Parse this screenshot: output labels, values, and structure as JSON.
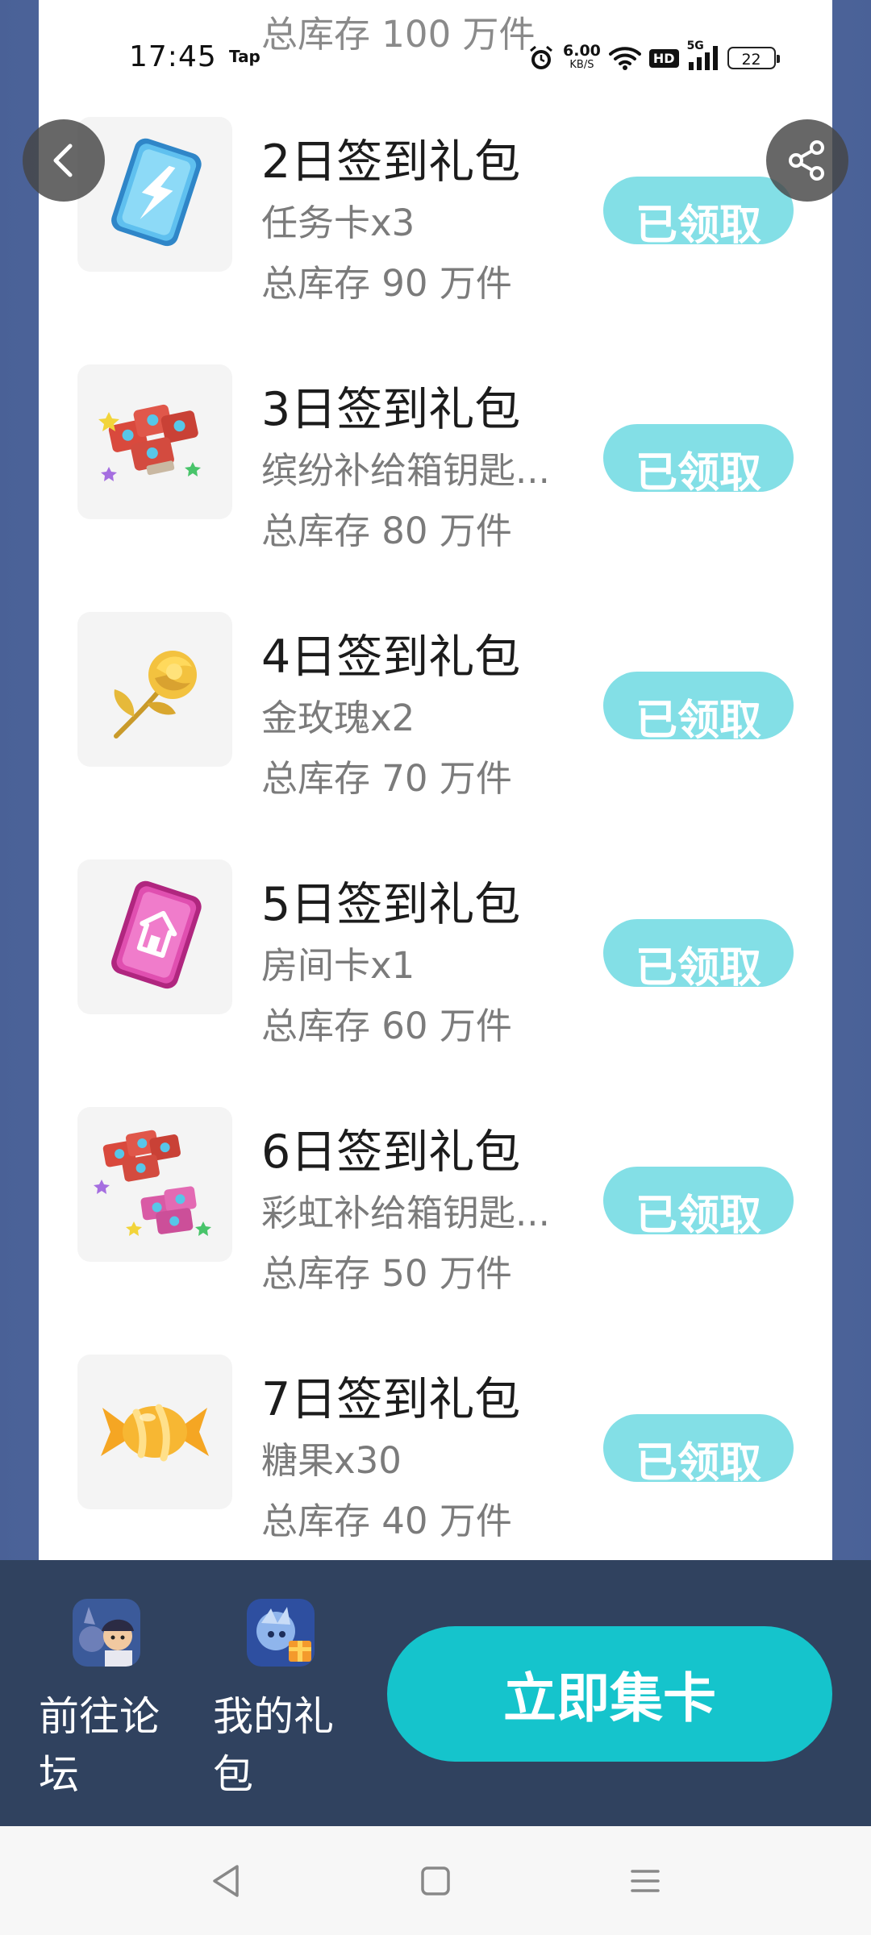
{
  "status_bar": {
    "time": "17:45",
    "tap_label": "Tap",
    "net_speed_value": "6.00",
    "net_speed_unit": "KB/S",
    "hd_label": "HD",
    "network_label": "5G",
    "battery_level": "22"
  },
  "top_partial_item": {
    "stock": "总库存 100 万件"
  },
  "items": [
    {
      "title": "2日签到礼包",
      "desc": "任务卡x3",
      "stock": "总库存 90 万件",
      "button": "已领取",
      "icon": "task-card-icon"
    },
    {
      "title": "3日签到礼包",
      "desc": "缤纷补给箱钥匙...",
      "stock": "总库存 80 万件",
      "button": "已领取",
      "icon": "supply-key-icon"
    },
    {
      "title": "4日签到礼包",
      "desc": "金玫瑰x2",
      "stock": "总库存 70 万件",
      "button": "已领取",
      "icon": "gold-rose-icon"
    },
    {
      "title": "5日签到礼包",
      "desc": "房间卡x1",
      "stock": "总库存 60 万件",
      "button": "已领取",
      "icon": "room-card-icon"
    },
    {
      "title": "6日签到礼包",
      "desc": "彩虹补给箱钥匙...",
      "stock": "总库存 50 万件",
      "button": "已领取",
      "icon": "rainbow-key-icon"
    },
    {
      "title": "7日签到礼包",
      "desc": "糖果x30",
      "stock": "总库存 40 万件",
      "button": "已领取",
      "icon": "candy-icon"
    }
  ],
  "bottom_bar": {
    "forum_label": "前往论坛",
    "gift_label": "我的礼包",
    "collect_label": "立即集卡"
  },
  "colors": {
    "claimed_button": "#83dfe6",
    "primary_button": "#15c4cc",
    "bottom_bar": "#30425f",
    "page_background": "#50689c"
  }
}
